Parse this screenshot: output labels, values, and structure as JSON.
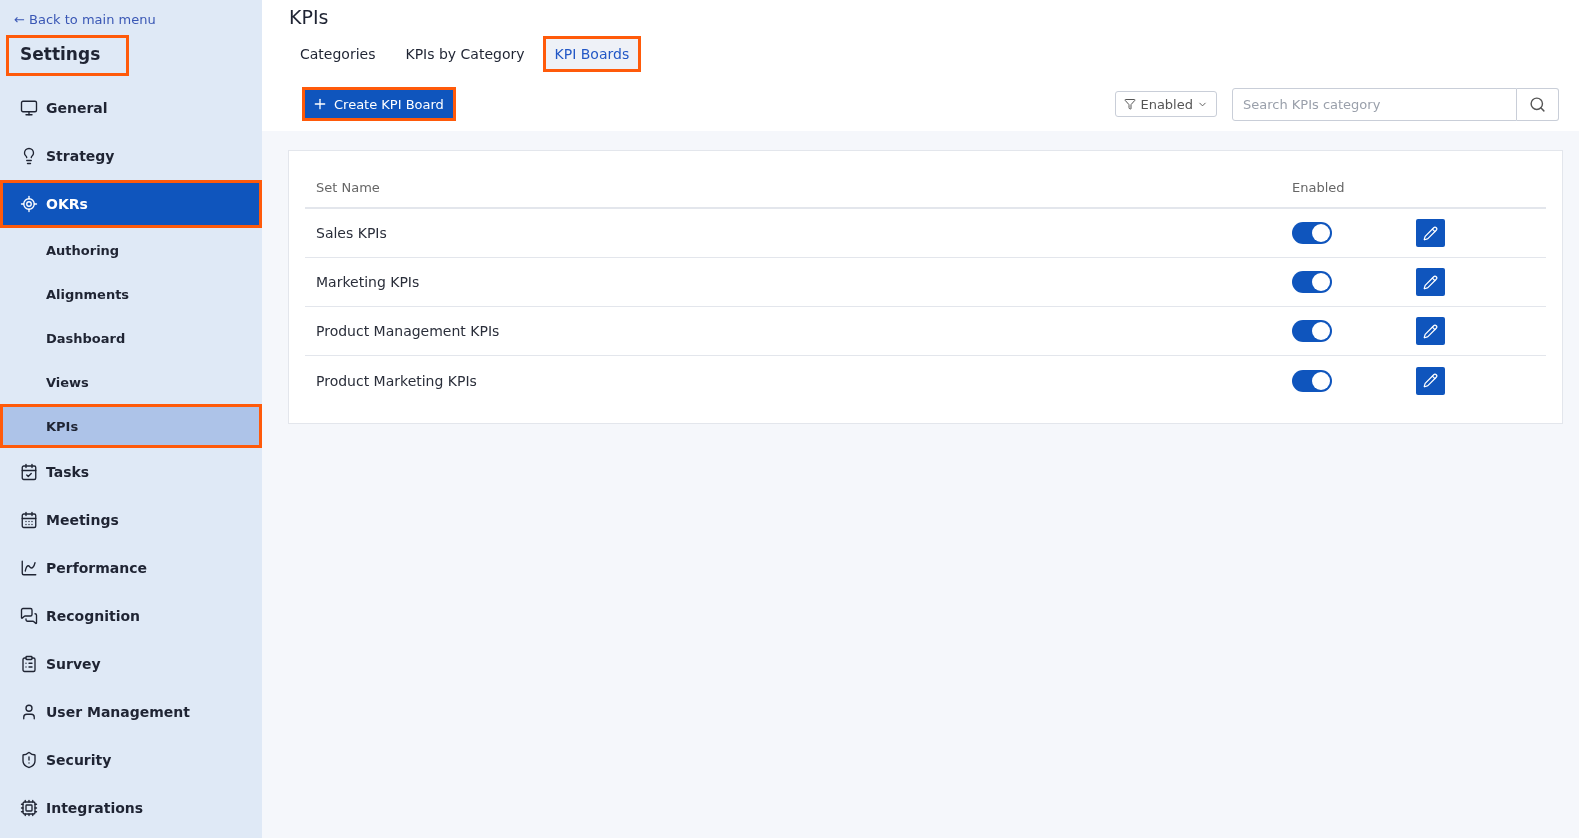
{
  "sidebar": {
    "back_link": "← Back to main menu",
    "title": {
      "label": "Settings",
      "highlighted": true
    },
    "items": [
      {
        "label": "General",
        "selected": false,
        "highlighted": false
      },
      {
        "label": "Strategy",
        "selected": false,
        "highlighted": false
      },
      {
        "label": "OKRs",
        "selected": true,
        "highlighted": true,
        "children": [
          {
            "label": "Authoring",
            "selected": false,
            "highlighted": false
          },
          {
            "label": "Alignments",
            "selected": false,
            "highlighted": false
          },
          {
            "label": "Dashboard",
            "selected": false,
            "highlighted": false
          },
          {
            "label": "Views",
            "selected": false,
            "highlighted": false
          },
          {
            "label": "KPIs",
            "selected": true,
            "highlighted": true
          }
        ]
      },
      {
        "label": "Tasks",
        "selected": false,
        "highlighted": false
      },
      {
        "label": "Meetings",
        "selected": false,
        "highlighted": false
      },
      {
        "label": "Performance",
        "selected": false,
        "highlighted": false
      },
      {
        "label": "Recognition",
        "selected": false,
        "highlighted": false
      },
      {
        "label": "Survey",
        "selected": false,
        "highlighted": false
      },
      {
        "label": "User Management",
        "selected": false,
        "highlighted": false
      },
      {
        "label": "Security",
        "selected": false,
        "highlighted": false
      },
      {
        "label": "Integrations",
        "selected": false,
        "highlighted": false
      }
    ]
  },
  "page": {
    "title": "KPIs",
    "tabs": [
      {
        "label": "Categories",
        "selected": false,
        "highlighted": false
      },
      {
        "label": "KPIs by Category",
        "selected": false,
        "highlighted": false
      },
      {
        "label": "KPI Boards",
        "selected": true,
        "highlighted": true
      }
    ],
    "create_button": {
      "label": "Create KPI Board",
      "highlighted": true
    },
    "filter": {
      "value": "Enabled"
    },
    "search": {
      "placeholder": "Search KPIs category"
    }
  },
  "table": {
    "columns": [
      "Set Name",
      "Enabled"
    ],
    "rows": [
      {
        "name": "Sales KPIs",
        "enabled": true
      },
      {
        "name": "Marketing KPIs",
        "enabled": true
      },
      {
        "name": "Product Management KPIs",
        "enabled": true
      },
      {
        "name": "Product Marketing KPIs",
        "enabled": true
      }
    ]
  }
}
